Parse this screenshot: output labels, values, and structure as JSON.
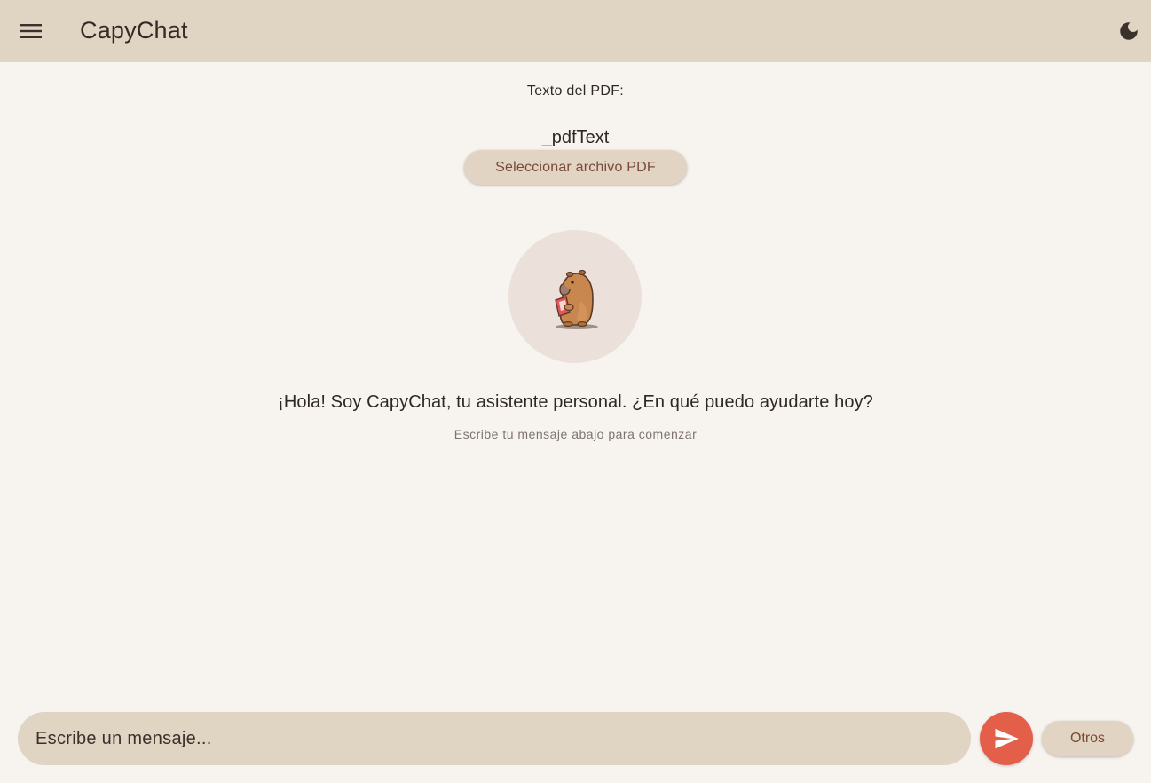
{
  "header": {
    "title": "CapyChat",
    "menu_icon": "menu-icon",
    "theme_icon": "dark-mode-icon"
  },
  "pdf": {
    "label": "Texto del PDF:",
    "text": "_pdfText",
    "select_button_label": "Seleccionar archivo PDF"
  },
  "welcome": {
    "avatar_icon": "capybara-reading-icon",
    "message": "¡Hola! Soy CapyChat, tu asistente personal. ¿En qué puedo ayudarte hoy?",
    "subtitle": "Escribe tu mensaje abajo para comenzar"
  },
  "composer": {
    "placeholder": "Escribe un mensaje...",
    "value": "",
    "send_icon": "send-icon",
    "other_button_label": "Otros"
  },
  "colors": {
    "appbar": "#e0d4c3",
    "background": "#f7f3ee",
    "send_button": "#e35f4a",
    "button_text": "#7a4a3a"
  }
}
